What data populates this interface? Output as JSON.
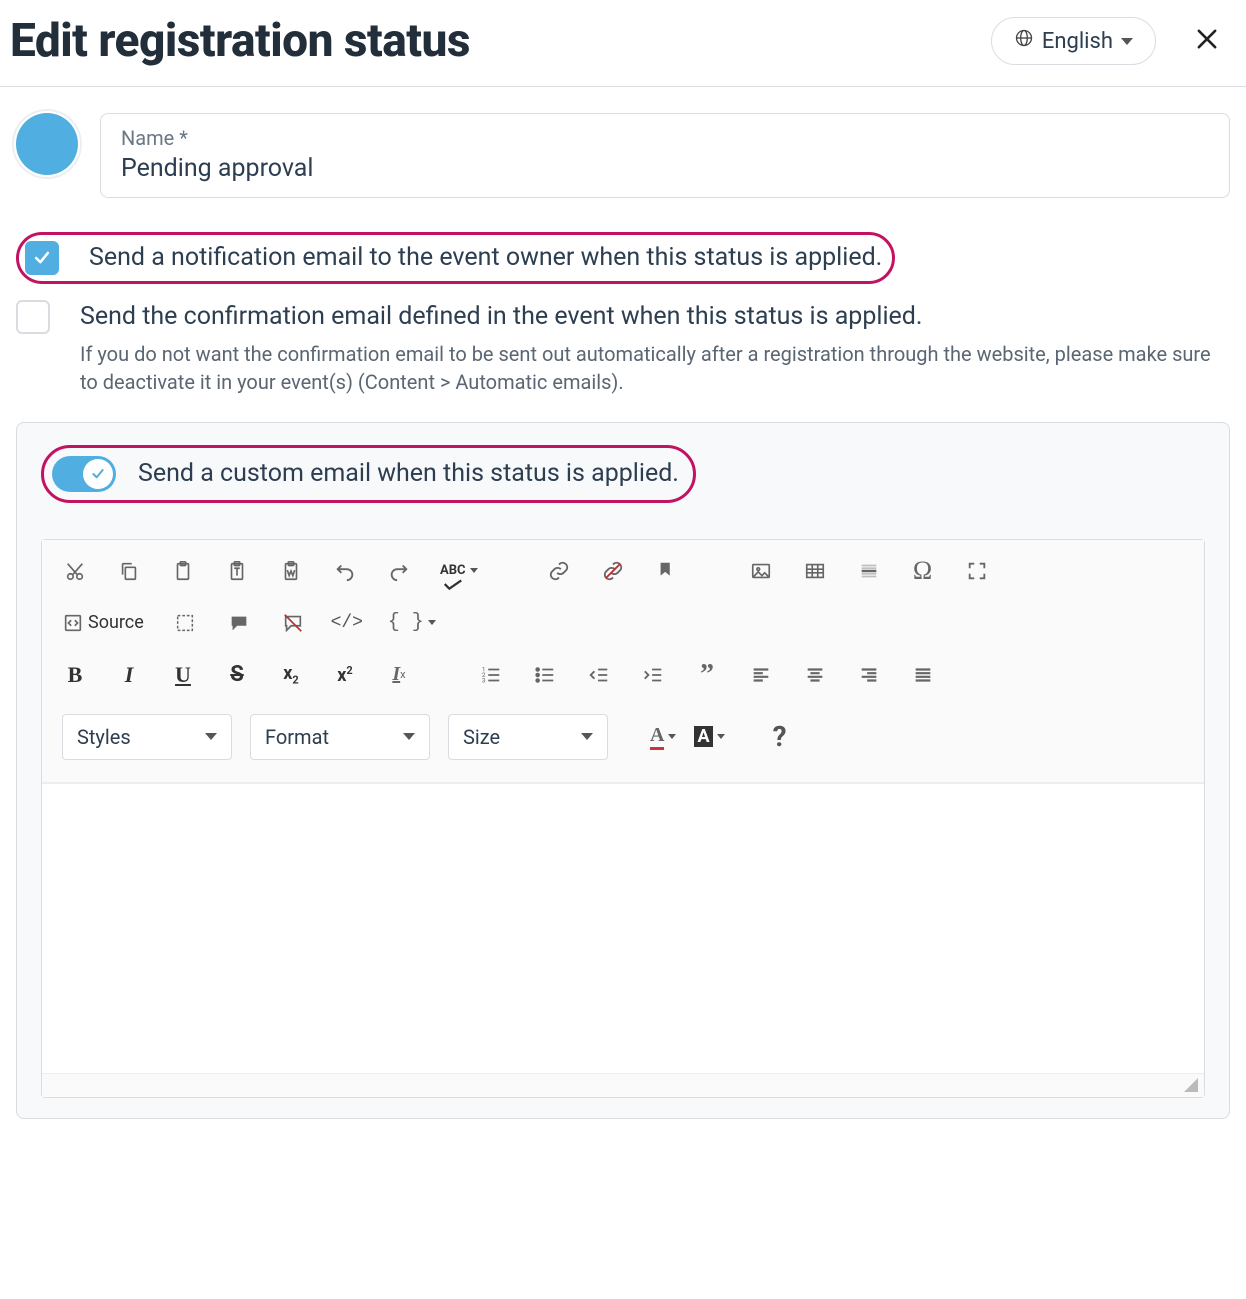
{
  "header": {
    "title": "Edit registration status",
    "language": "English"
  },
  "form": {
    "name_label": "Name *",
    "name_value": "Pending approval"
  },
  "options": {
    "notify_owner": {
      "checked": true,
      "label": "Send a notification email to the event owner when this status is applied."
    },
    "send_confirmation": {
      "checked": false,
      "label": "Send the confirmation email defined in the event when this status is applied.",
      "hint": "If you do not want the confirmation email to be sent out automatically after a registration through the website, please make sure to deactivate it in your event(s) (Content > Automatic emails)."
    },
    "custom_email": {
      "enabled": true,
      "label": "Send a custom email when this status is applied."
    }
  },
  "editor": {
    "source_label": "Source",
    "brace_label": "{ }",
    "dropdowns": {
      "styles": "Styles",
      "format": "Format",
      "size": "Size"
    },
    "content": ""
  },
  "colors": {
    "swatch": "#51aee0"
  }
}
